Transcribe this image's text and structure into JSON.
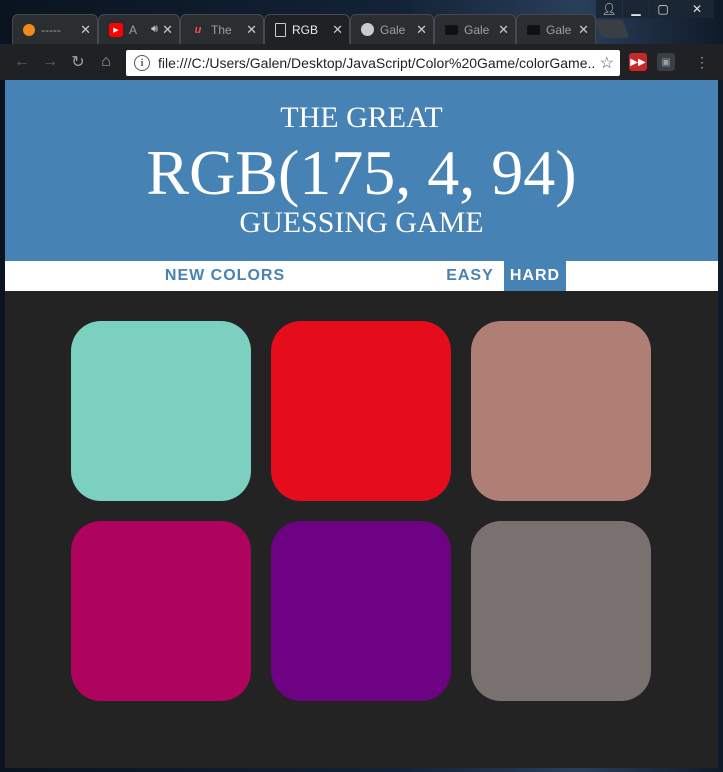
{
  "browser": {
    "tabs": [
      {
        "title": "-----",
        "favicon": "orange-circle-icon",
        "active": false
      },
      {
        "title": "A",
        "favicon": "youtube-icon",
        "audio": true,
        "active": false
      },
      {
        "title": "The",
        "favicon": "udemy-icon",
        "active": false
      },
      {
        "title": "RGB",
        "favicon": "document-icon",
        "active": true
      },
      {
        "title": "Gale",
        "favicon": "github-icon",
        "active": false
      },
      {
        "title": "Gale",
        "favicon": "folder-icon",
        "active": false
      },
      {
        "title": "Gale",
        "favicon": "folder-icon",
        "active": false
      }
    ],
    "address": "file:///C:/Users/Galen/Desktop/JavaScript/Color%20Game/colorGame...",
    "icons": {
      "back": "back-arrow-icon",
      "forward": "forward-arrow-icon",
      "reload": "reload-icon",
      "home": "home-icon",
      "info": "info-icon",
      "star": "star-icon",
      "menu": "kebab-menu-icon"
    },
    "window_controls": [
      "profile-icon",
      "minimize-icon",
      "maximize-icon",
      "close-icon"
    ]
  },
  "game": {
    "header": {
      "line1": "THE GREAT",
      "target": "RGB(175, 4, 94)",
      "line3": "GUESSING GAME"
    },
    "stripe": {
      "reset_label": "NEW COLORS",
      "message": "",
      "easy_label": "EASY",
      "hard_label": "HARD",
      "selected_mode": "hard"
    },
    "squares": [
      {
        "color": "#7bd0bf"
      },
      {
        "color": "#e50d1c"
      },
      {
        "color": "#af7e74"
      },
      {
        "color": "#af045e"
      },
      {
        "color": "#6d0283"
      },
      {
        "color": "#79716f"
      }
    ],
    "colors": {
      "header_bg": "#4682b4",
      "page_bg": "#232323",
      "stripe_bg": "#ffffff"
    }
  }
}
